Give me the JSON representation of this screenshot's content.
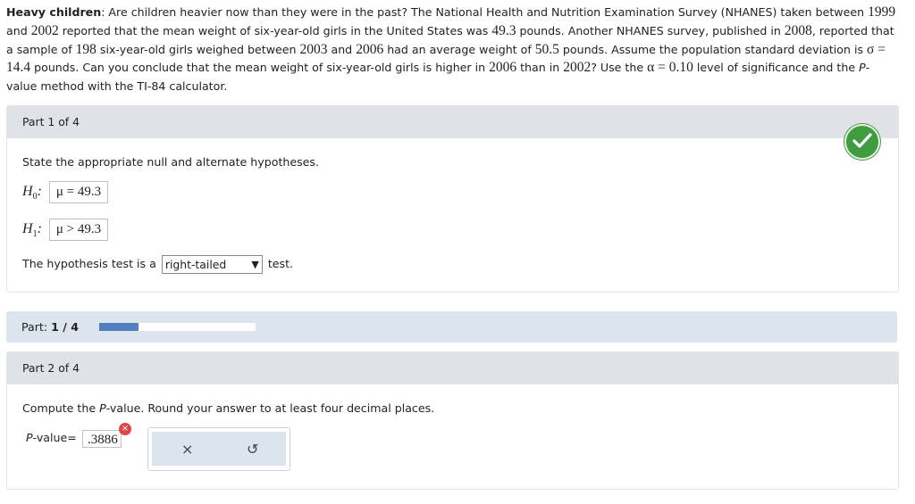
{
  "problem": {
    "title": "Heavy children",
    "segments": [
      {
        "t": "text",
        "v": ": Are children heavier now than they were in the past? The National Health and Nutrition Examination Survey (NHANES) taken between "
      },
      {
        "t": "num",
        "v": "1999"
      },
      {
        "t": "text",
        "v": " and "
      },
      {
        "t": "num",
        "v": "2002"
      },
      {
        "t": "text",
        "v": " reported that the mean weight of six-year-old girls in the United States was "
      },
      {
        "t": "num",
        "v": "49.3"
      },
      {
        "t": "text",
        "v": " pounds. Another NHANES survey, published in "
      },
      {
        "t": "num",
        "v": "2008"
      },
      {
        "t": "text",
        "v": ", reported that a sample of "
      },
      {
        "t": "num",
        "v": "198"
      },
      {
        "t": "text",
        "v": " six-year-old girls weighed between "
      },
      {
        "t": "num",
        "v": "2003"
      },
      {
        "t": "text",
        "v": " and "
      },
      {
        "t": "num",
        "v": "2006"
      },
      {
        "t": "text",
        "v": " had an average weight of "
      },
      {
        "t": "num",
        "v": "50.5"
      },
      {
        "t": "text",
        "v": " pounds. Assume the population standard deviation is "
      },
      {
        "t": "num",
        "v": "σ = 14.4"
      },
      {
        "t": "text",
        "v": " pounds. Can you conclude that the mean weight of six-year-old girls is higher in "
      },
      {
        "t": "num",
        "v": "2006"
      },
      {
        "t": "text",
        "v": " than in "
      },
      {
        "t": "num",
        "v": "2002"
      },
      {
        "t": "text",
        "v": "? Use the "
      },
      {
        "t": "num",
        "v": "α = 0.10"
      },
      {
        "t": "text",
        "v": " level of significance and the "
      },
      {
        "t": "ital",
        "v": "P"
      },
      {
        "t": "text",
        "v": "-value method with the TI-84 calculator."
      }
    ]
  },
  "part1": {
    "header": "Part 1 of 4",
    "instruction": "State the appropriate null and alternate hypotheses.",
    "h0_label": "H",
    "h0_sub": "0",
    "h0_value": "μ = 49.3",
    "h1_label": "H",
    "h1_sub": "1",
    "h1_value": "μ > 49.3",
    "test_prefix": "The hypothesis test is a",
    "test_selected": "right-tailed",
    "test_suffix": "test."
  },
  "progress": {
    "label_prefix": "Part: ",
    "label_value": "1 / 4",
    "fraction": 0.25
  },
  "part2": {
    "header": "Part 2 of 4",
    "instruction_prefix": "Compute the ",
    "instruction_ital": "P",
    "instruction_suffix": "-value. Round your answer to at least four decimal places.",
    "pvalue_label_ital": "P",
    "pvalue_label_rest": "-value",
    "pvalue_eq": "=",
    "pvalue_input": ".3886",
    "error_icon": "×",
    "clear_button": "×",
    "undo_button": "↺"
  },
  "colors": {
    "header_bg": "#dfe3e8",
    "check_green": "#3f9d3f",
    "progress_fill": "#4f80c0",
    "error_red": "#e04646"
  }
}
